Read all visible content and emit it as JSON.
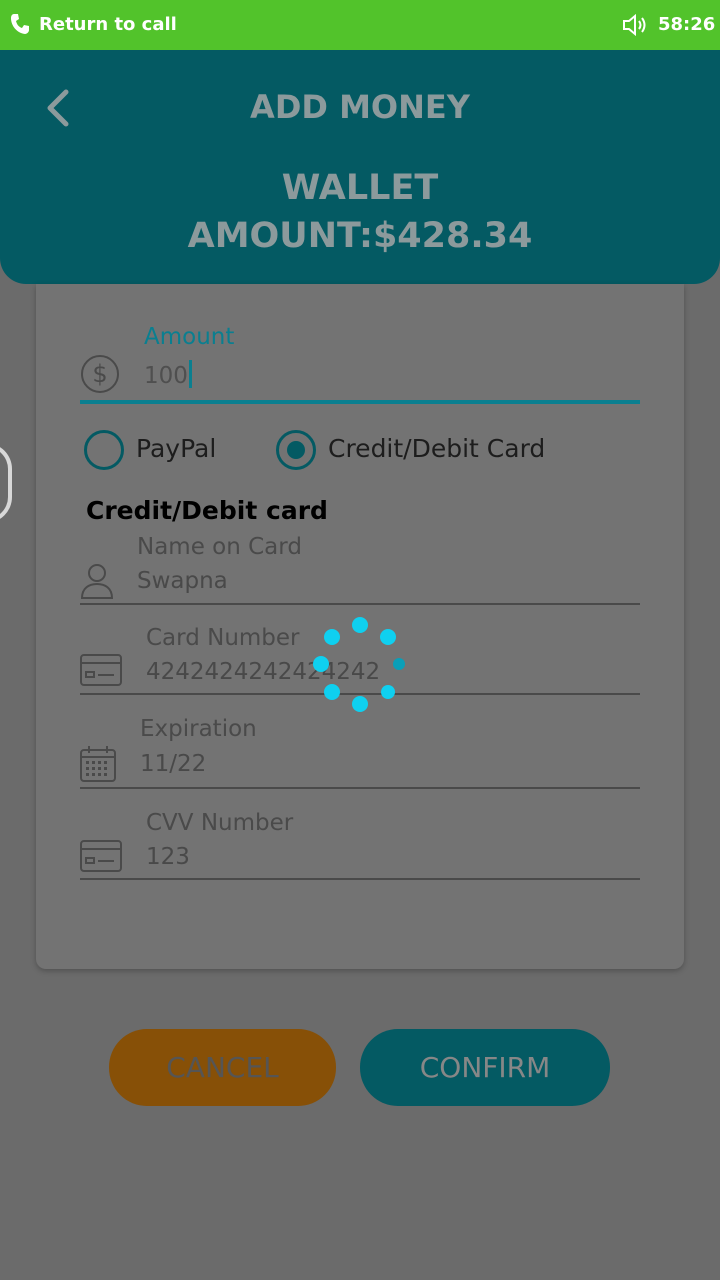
{
  "status_bar": {
    "return_label": "Return to call",
    "time": "58:26",
    "icons": [
      "phone-icon",
      "volume-icon"
    ]
  },
  "header": {
    "title": "ADD MONEY",
    "wallet_label": "WALLET",
    "wallet_amount": "AMOUNT:$428.34"
  },
  "form": {
    "amount": {
      "label": "Amount",
      "value": "100"
    },
    "payment_methods": [
      {
        "label": "PayPal",
        "selected": false
      },
      {
        "label": "Credit/Debit Card",
        "selected": true
      }
    ],
    "section_title": "Credit/Debit card",
    "name": {
      "label": "Name on Card",
      "value": "Swapna"
    },
    "card_number": {
      "label": "Card Number",
      "value": "4242424242424242"
    },
    "expiration": {
      "label": "Expiration",
      "value": "11/22"
    },
    "cvv": {
      "label": "CVV Number",
      "value": "123"
    }
  },
  "buttons": {
    "cancel": "CANCEL",
    "confirm": "CONFIRM"
  },
  "colors": {
    "accent": "#0a7f90",
    "header": "#045a63",
    "call_bar": "#52c32b",
    "cancel": "#875007",
    "spinner": "#0fd0f0"
  }
}
